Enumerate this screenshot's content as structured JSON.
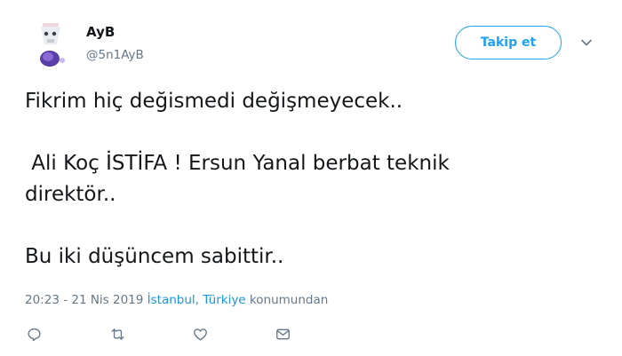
{
  "author": {
    "name": "AyB",
    "handle": "@5n1AyB"
  },
  "follow_button": {
    "label": "Takip et"
  },
  "tweet": {
    "lines": [
      "Fikrim hiç değismedi değişmeyecek..",
      "",
      " Ali Koç İSTİFA ! Ersun Yanal berbat teknik",
      "direktör..",
      "",
      "Bu iki düşüncem sabittir.."
    ]
  },
  "meta": {
    "datetime": "20:23 - 21 Nis 2019",
    "location": "İstanbul, Türkiye",
    "location_suffix": "konumundan"
  },
  "actions": [
    {
      "icon": "reply-icon"
    },
    {
      "icon": "retweet-icon"
    },
    {
      "icon": "like-icon"
    },
    {
      "icon": "direct-message-icon"
    }
  ],
  "colors": {
    "accent": "#1da1f2",
    "link": "#1b95e0",
    "secondary_text": "#657786",
    "primary_text": "#14171a"
  }
}
